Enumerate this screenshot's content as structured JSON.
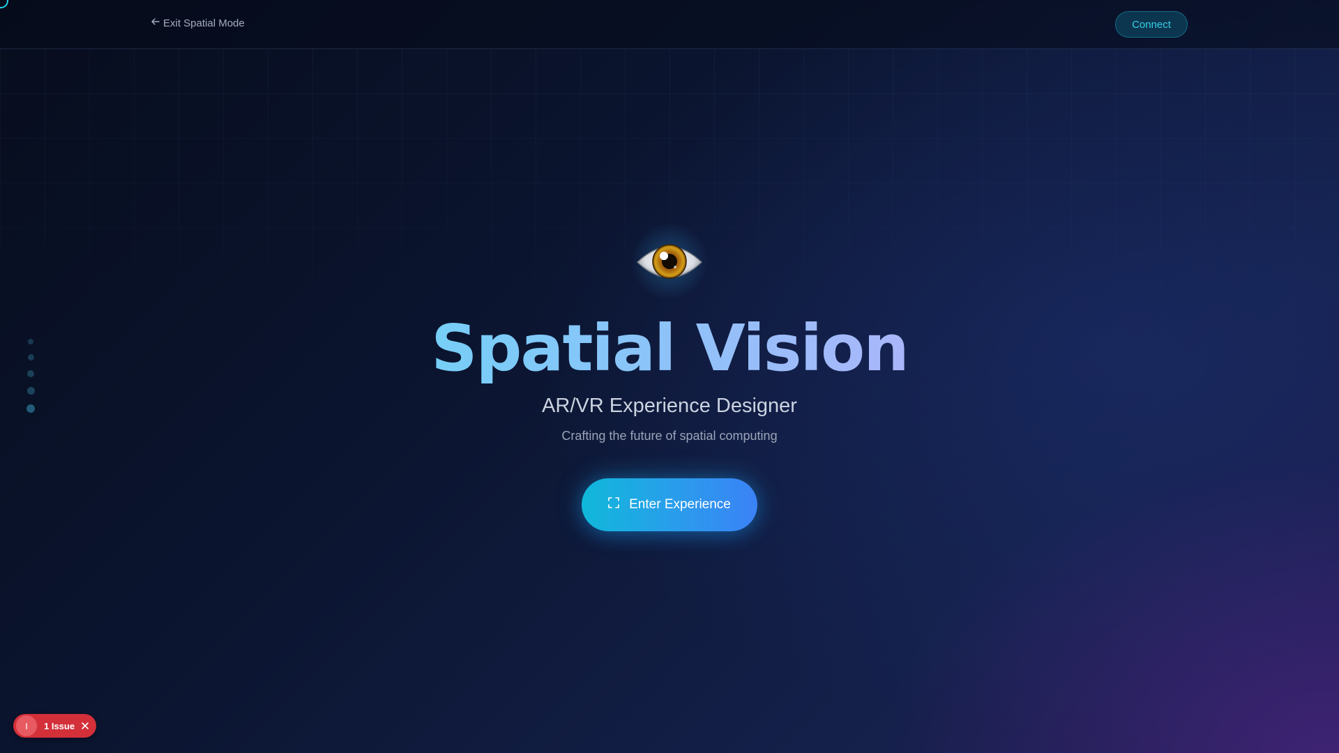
{
  "header": {
    "exit_label": "Exit Spatial Mode",
    "connect_label": "Connect"
  },
  "hero": {
    "icon": "eye-icon",
    "title": "Spatial Vision",
    "subtitle": "AR/VR Experience Designer",
    "tagline": "Crafting the future of spatial computing",
    "cta_label": "Enter Experience",
    "cta_icon": "expand-icon"
  },
  "side_nav": {
    "dot_count": 5
  },
  "issues_badge": {
    "indicator": "I",
    "label": "1 Issue"
  },
  "colors": {
    "accent_cyan": "#22d3ee",
    "accent_blue": "#3b82f6",
    "title_gradient": [
      "#4ee3f4",
      "#86c6f8",
      "#b6b1fb",
      "#d8acf6"
    ],
    "issue_red": "#d3303a",
    "background_dark": "#070d1d"
  }
}
